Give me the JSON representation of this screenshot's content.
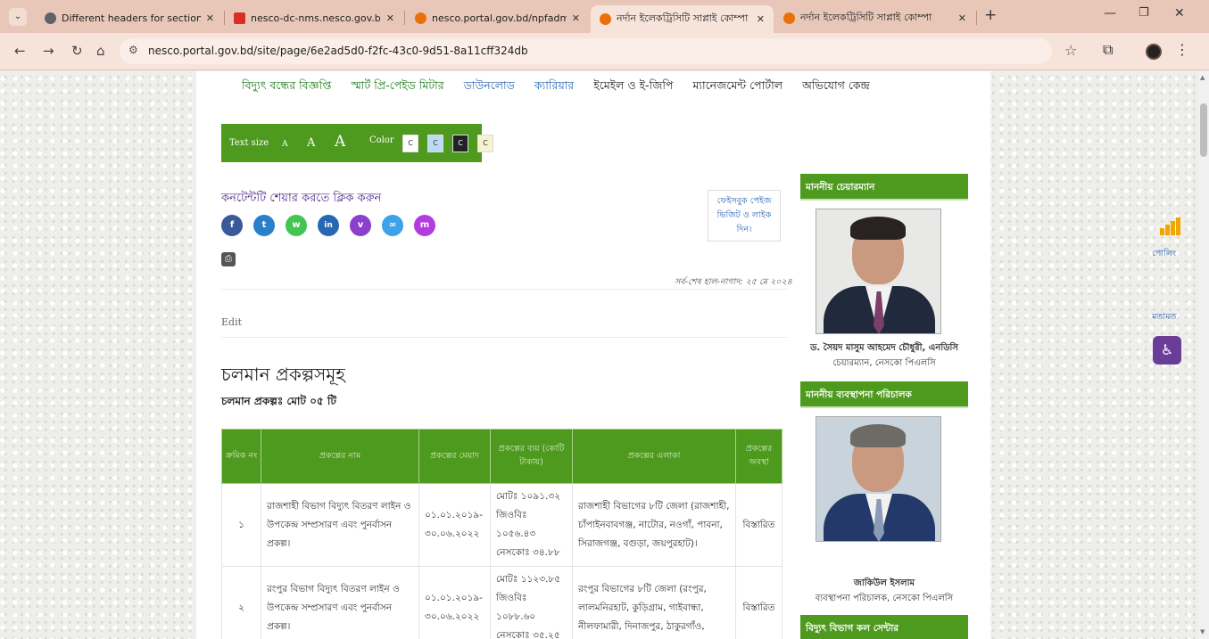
{
  "browser": {
    "tabs": [
      {
        "title": "Different headers for sections",
        "favicon_color": "#5f6368",
        "active": false
      },
      {
        "title": "nesco-dc-nms.nesco.gov.bd: H",
        "favicon_color": "#d93025",
        "active": false
      },
      {
        "title": "nesco.portal.gov.bd/npfadmin/",
        "favicon_color": "#e8710a",
        "active": false
      },
      {
        "title": "নর্দান ইলেকট্রিসিটি সাপ্লাই কোম্পা",
        "favicon_color": "#e8710a",
        "active": true
      },
      {
        "title": "নর্দান ইলেকট্রিসিটি সাপ্লাই কোম্পা",
        "favicon_color": "#e8710a",
        "active": false
      }
    ],
    "url": "nesco.portal.gov.bd/site/page/6e2ad5d0-f2fc-43c0-9d51-8a11cff324db"
  },
  "topnav": [
    {
      "label": "বিদ্যুৎ বন্ধের বিজ্ঞপ্তি",
      "color": "green"
    },
    {
      "label": "স্মার্ট প্রি-পেইড মিটার",
      "color": "green"
    },
    {
      "label": "ডাউনলোড",
      "color": "blue"
    },
    {
      "label": "ক্যারিয়ার",
      "color": "blue"
    },
    {
      "label": "ইমেইল ও ই-জিপি",
      "color": "dark"
    },
    {
      "label": "ম্যানেজমেন্ট পোর্টাল",
      "color": "dark"
    },
    {
      "label": "অভিযোগ কেন্দ্র",
      "color": "dark"
    }
  ],
  "accessibility": {
    "text_size_label": "Text size",
    "a_small": "A",
    "a_medium": "A",
    "a_large": "A",
    "color_label": "Color",
    "color_options": [
      {
        "label": "C",
        "bg": "#ffffff",
        "fg": "#333333"
      },
      {
        "label": "C",
        "bg": "#bcd9f5",
        "fg": "#333333"
      },
      {
        "label": "C",
        "bg": "#222222",
        "fg": "#ffffff"
      },
      {
        "label": "C",
        "bg": "#f7f2d4",
        "fg": "#333333"
      }
    ]
  },
  "share": {
    "title": "কনটেন্টটি শেয়ার করতে ক্লিক করুন",
    "buttons": [
      {
        "name": "facebook-icon",
        "glyph": "f",
        "color": "#3b5998"
      },
      {
        "name": "twitter-icon",
        "glyph": "t",
        "color": "#2a7fc9"
      },
      {
        "name": "whatsapp-icon",
        "glyph": "w",
        "color": "#43c553"
      },
      {
        "name": "linkedin-icon",
        "glyph": "in",
        "color": "#2867b2"
      },
      {
        "name": "viber-icon",
        "glyph": "v",
        "color": "#8c3fcf"
      },
      {
        "name": "copy-link-icon",
        "glyph": "∞",
        "color": "#3ea2e8"
      },
      {
        "name": "messenger-icon",
        "glyph": "m",
        "color": "#b23ce0"
      }
    ],
    "facebook_box": "ফেইসবুক পেইজ ভিজিট ও লাইক দিন।"
  },
  "updated_text": "সর্ব-শেষ হাল-নাগাদ: ২৫ মে ২০২৪",
  "edit_label": "Edit",
  "content": {
    "title": "চলমান প্রকল্পসমূহ",
    "count": "চলমান প্রকল্পঃ মোট ০৫ টি",
    "table": {
      "headers": [
        "ক্রমিক নং",
        "প্রকল্পের নাম",
        "প্রকল্পের মেয়াদ",
        "প্রকল্পের ব্যয় (কোটি টাকায়)",
        "প্রকল্পের এলাকা",
        "প্রকল্পের অবস্থা"
      ],
      "rows": [
        [
          "১",
          "রাজশাহী বিভাগ বিদ্যুৎ বিতরণ লাইন ও উপকেন্দ্র সম্প্রসারণ এবং পুনর্বাসন প্রকল্প।",
          "০১.০১.২০১৯- ৩০.০৬.২০২২",
          "মোটঃ ১০৯১.৩২ জিওবিঃ ১০৫৬.৪৩ নেসকোঃ ৩৪.৮৮",
          "রাজশাহী বিভাগের ৮টি জেলা (রাজশাহী, চাঁপাইনবাবগঞ্জ, নাটোর, নওগাঁ, পাবনা, সিরাজগঞ্জ, বগুড়া, জয়পুরহাট)।",
          "বিস্তারিত"
        ],
        [
          "২",
          "রংপুর বিভাগ বিদ্যুৎ বিতরণ লাইন ও উপকেন্দ্র সম্প্রসারণ এবং পুনর্বাসন প্রকল্প।",
          "০১.০১.২০১৯- ৩০.০৬.২০২২",
          "মোটঃ ১১২৩.৮৫ জিওবিঃ ১০৮৮.৬০ নেসকোঃ ৩৫.২৫",
          "রংপুর বিভাগের ৮টি জেলা (রংপুর, লালমনিরহাট, কুড়িগ্রাম, গাইবান্ধা, নীলফামারী, দিনাজপুর, ঠাকুরগাঁও,",
          "বিস্তারিত"
        ]
      ]
    }
  },
  "sidebar": {
    "chairman_title": "মাননীয় চেয়ারম্যান",
    "chairman_name": "ড. সৈয়দ মাসুম আহমেদ চৌধুরী, এনডিসি",
    "chairman_role": "চেয়ারম্যান, নেসকো পিএলসি",
    "md_title": "মাননীয় ব্যবস্থাপনা পরিচালক",
    "md_name": "জাকিউল ইসলাম",
    "md_role": "ব্যবস্থাপনা পরিচালক, নেসকো পিএলসি",
    "callcenter_title": "বিদ্যুৎ বিভাগ কল সেন্টার"
  },
  "floating": {
    "poll_label": "পোলিং",
    "feedback_label": "মতামত"
  },
  "colors": {
    "brand_green": "#4e9a1f",
    "tab_strip": "#e9c7b8",
    "link_blue": "#2b63b0"
  }
}
